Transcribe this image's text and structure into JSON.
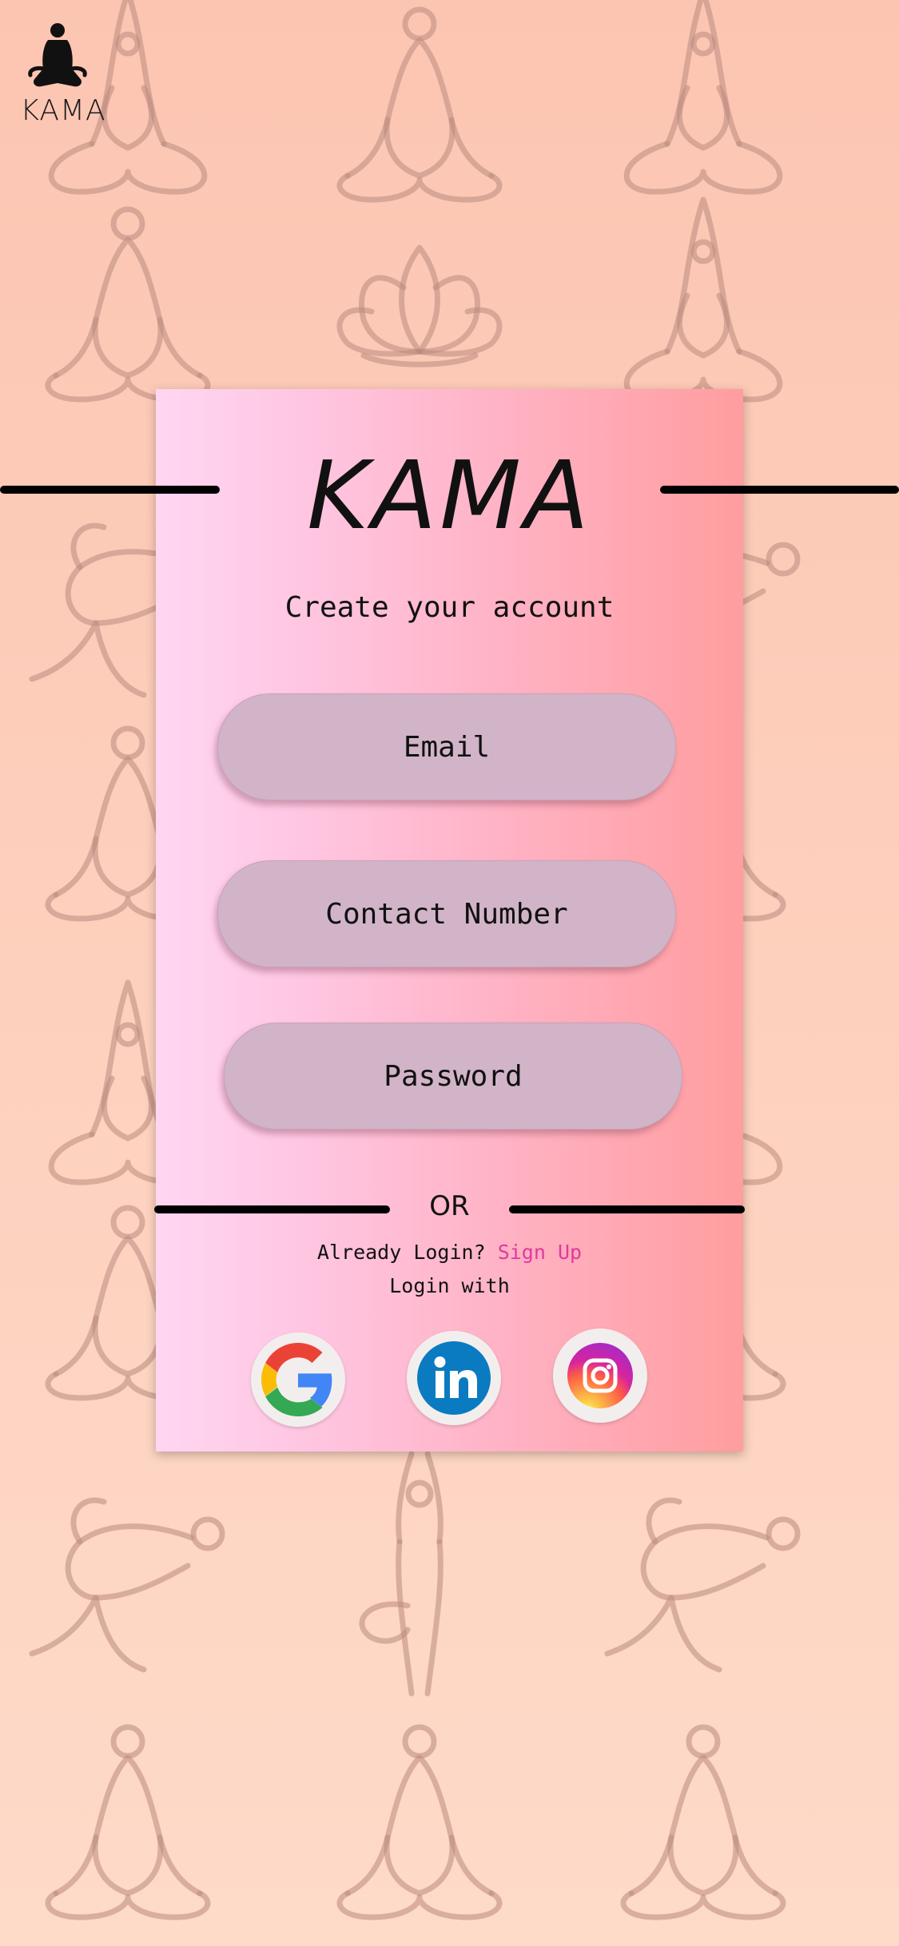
{
  "app": {
    "logo_text": "KAMA",
    "brand_title": "KAMA",
    "subtitle": "Create your account"
  },
  "form": {
    "email_placeholder": "Email",
    "contact_placeholder": "Contact Number",
    "password_placeholder": "Password"
  },
  "divider": {
    "or_text": "OR"
  },
  "footer": {
    "already_text": "Already Login?",
    "signup_link": "Sign Up",
    "login_with": "Login with"
  },
  "social": [
    {
      "name": "google-icon"
    },
    {
      "name": "linkedin-icon"
    },
    {
      "name": "instagram-icon"
    }
  ],
  "colors": {
    "accent_link": "#e0399f",
    "field_bg": "#d2b4c8",
    "linkedin_blue": "#0a7bc1"
  }
}
